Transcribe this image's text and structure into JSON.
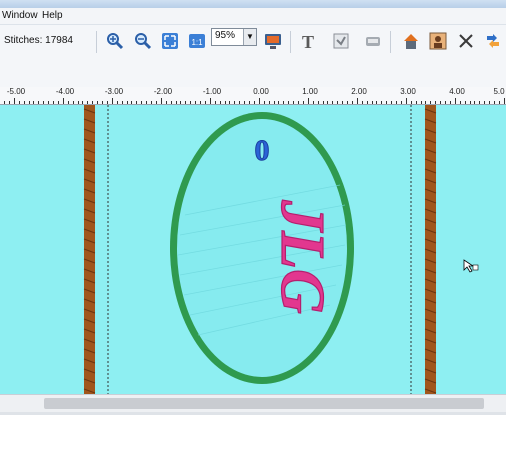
{
  "window": {
    "title": ""
  },
  "menu": {
    "items": [
      "Window",
      "Help"
    ]
  },
  "toolbar": {
    "stitches_label": "Stitches: 17984",
    "zoom_value": "95%",
    "buttons": [
      "zoom-in",
      "zoom-out",
      "zoom-fit",
      "zoom-1to1",
      "preview",
      "text",
      "merge",
      "sew",
      "home",
      "photo",
      "delete",
      "convert"
    ]
  },
  "ruler": {
    "labels": [
      "-5.00",
      "-4.00",
      "-3.00",
      "-2.00",
      "-1.00",
      "0.00",
      "1.00",
      "2.00",
      "3.00",
      "4.00",
      "5.0"
    ]
  },
  "design": {
    "top_letter": "0",
    "monogram_text": "JLG",
    "fill_color": "#86ebef",
    "border_color": "#2f9a4f",
    "text_color": "#e2378f",
    "letter_color": "#2a63d6"
  },
  "colors": {
    "canvas": "#8eeff2",
    "bar": "#a0561c",
    "toolbar": "#f4f6f9"
  }
}
